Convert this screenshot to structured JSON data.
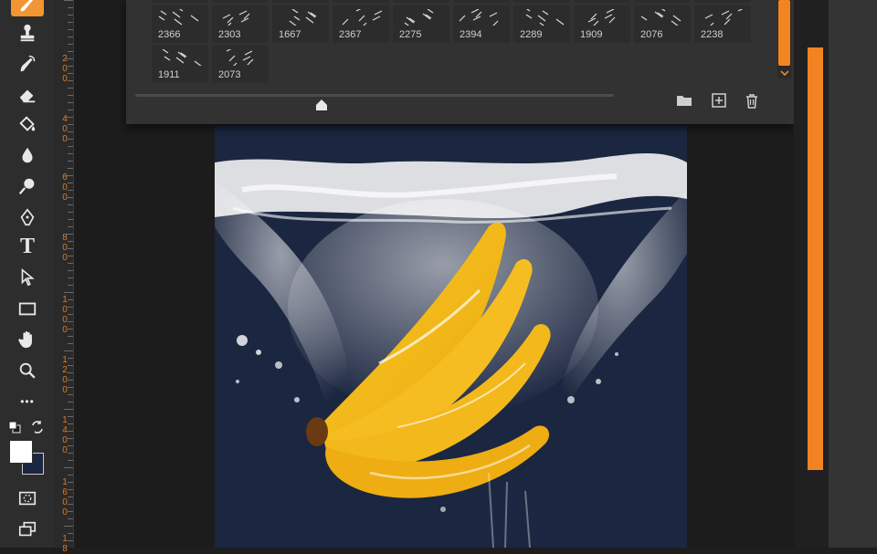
{
  "toolbar": {
    "tools": [
      {
        "name": "brush-tool-icon",
        "active": true
      },
      {
        "name": "clone-stamp-tool-icon"
      },
      {
        "name": "history-brush-tool-icon"
      },
      {
        "name": "eraser-tool-icon"
      },
      {
        "name": "paint-bucket-tool-icon"
      },
      {
        "name": "blur-tool-icon"
      },
      {
        "name": "dodge-tool-icon"
      },
      {
        "name": "pen-tool-icon"
      },
      {
        "name": "type-tool-icon"
      },
      {
        "name": "path-selection-tool-icon"
      },
      {
        "name": "rectangle-tool-icon"
      },
      {
        "name": "hand-tool-icon"
      },
      {
        "name": "zoom-tool-icon"
      },
      {
        "name": "more-tools-icon"
      },
      {
        "name": "default-colors-icon"
      },
      {
        "name": "swap-colors-icon"
      },
      {
        "name": "color-swatches"
      },
      {
        "name": "quick-mask-icon"
      },
      {
        "name": "screen-mode-icon"
      }
    ],
    "type_tool_label": "T",
    "more_label": "•••",
    "foreground_color": "#ffffff",
    "background_color": "#1b2640",
    "accent_color": "#f29533"
  },
  "ruler": {
    "labels": [
      "2",
      "0",
      "0",
      "4",
      "0",
      "0",
      "6",
      "0",
      "0",
      "8",
      "0",
      "0",
      "1",
      "0",
      "0",
      "0",
      "1",
      "2",
      "0",
      "0",
      "1",
      "4",
      "0",
      "0",
      "1",
      "6",
      "0",
      "0",
      "1",
      "8"
    ],
    "color": "#e07a22"
  },
  "brushes_panel": {
    "row1": [
      "2366",
      "2303",
      "1667",
      "2367",
      "2275",
      "2394",
      "2289",
      "1909",
      "2076",
      "2238"
    ],
    "row2": [
      "1911",
      "2073"
    ],
    "buttons": {
      "new_group": "folder-icon",
      "new_preset": "plus-square-icon",
      "delete": "trash-icon"
    },
    "scroll_color": "#f2851f"
  },
  "canvas": {
    "subject": "bananas splashing into water",
    "background": "#1b2640"
  },
  "right_bar_color": "#f28322"
}
